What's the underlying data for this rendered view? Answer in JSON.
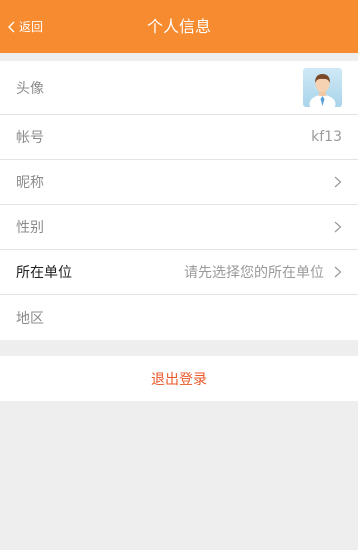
{
  "header": {
    "back_label": "返回",
    "title": "个人信息",
    "background": "#f68b30"
  },
  "rows": [
    {
      "label": "头像",
      "value": "",
      "icon": "avatar"
    },
    {
      "label": "帐号",
      "value": "kf13"
    },
    {
      "label": "昵称",
      "value": "",
      "icon": "chevron-right-icon"
    },
    {
      "label": "性别",
      "value": "",
      "icon": "chevron-right-icon"
    },
    {
      "label": "所在单位",
      "value": "请先选择您的所在单位",
      "icon": "chevron-right-icon"
    },
    {
      "label": "地区",
      "value": ""
    }
  ],
  "logout": {
    "label": "退出登录",
    "color": "#ea5a2a"
  }
}
